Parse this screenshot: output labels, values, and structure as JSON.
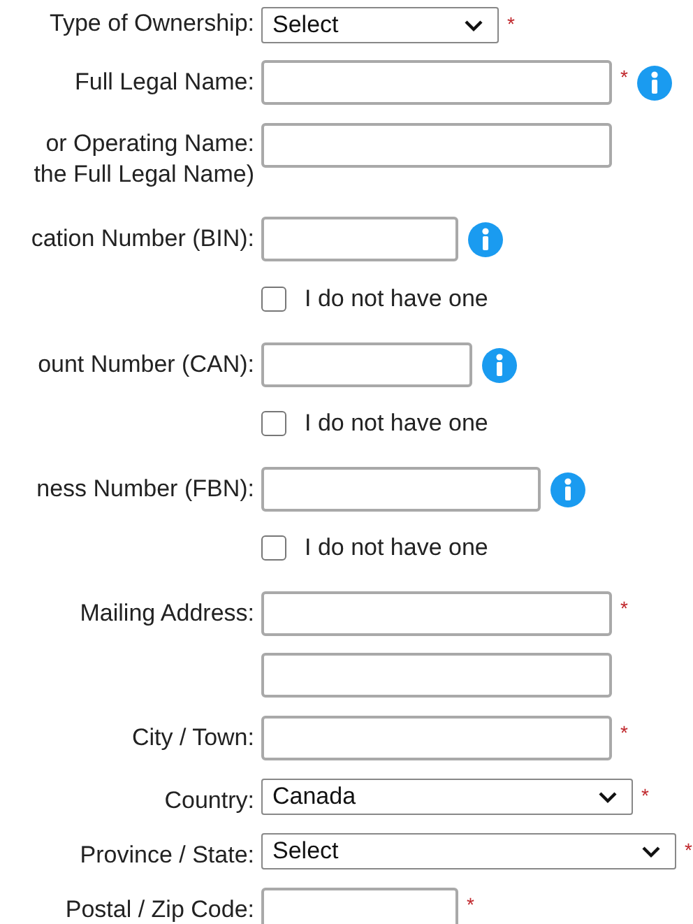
{
  "fields": [
    {
      "kind": "select",
      "label": "Type of Ownership:",
      "value": "Select",
      "required_mark": "*",
      "info": false
    },
    {
      "kind": "text",
      "label": "Full Legal Name:",
      "required_mark": "*",
      "info": true
    },
    {
      "kind": "text",
      "label": "or Operating Name:",
      "label_2": "the Full Legal Name)",
      "info": false
    },
    {
      "kind": "text",
      "label": "cation Number (BIN):",
      "info": true
    },
    {
      "kind": "checkbox",
      "text": "I do not have one",
      "checked": false
    },
    {
      "kind": "text",
      "label": "ount Number (CAN):",
      "info": true
    },
    {
      "kind": "checkbox",
      "text": "I do not have one",
      "checked": false
    },
    {
      "kind": "text",
      "label": "ness Number (FBN):",
      "info": true
    },
    {
      "kind": "checkbox",
      "text": "I do not have one",
      "checked": false
    },
    {
      "kind": "text",
      "label": "Mailing Address:",
      "required_mark": "*",
      "info": false
    },
    {
      "kind": "text",
      "info": false
    },
    {
      "kind": "text",
      "label": "City / Town:",
      "required_mark": "*",
      "info": false
    },
    {
      "kind": "select",
      "label": "Country:",
      "value": "Canada",
      "required_mark": "*",
      "info": false
    },
    {
      "kind": "select",
      "label": "Province / State:",
      "value": "Select",
      "required_mark": "*",
      "info": false
    },
    {
      "kind": "text",
      "label": "Postal / Zip Code:",
      "required_mark": "*",
      "info": false
    }
  ]
}
